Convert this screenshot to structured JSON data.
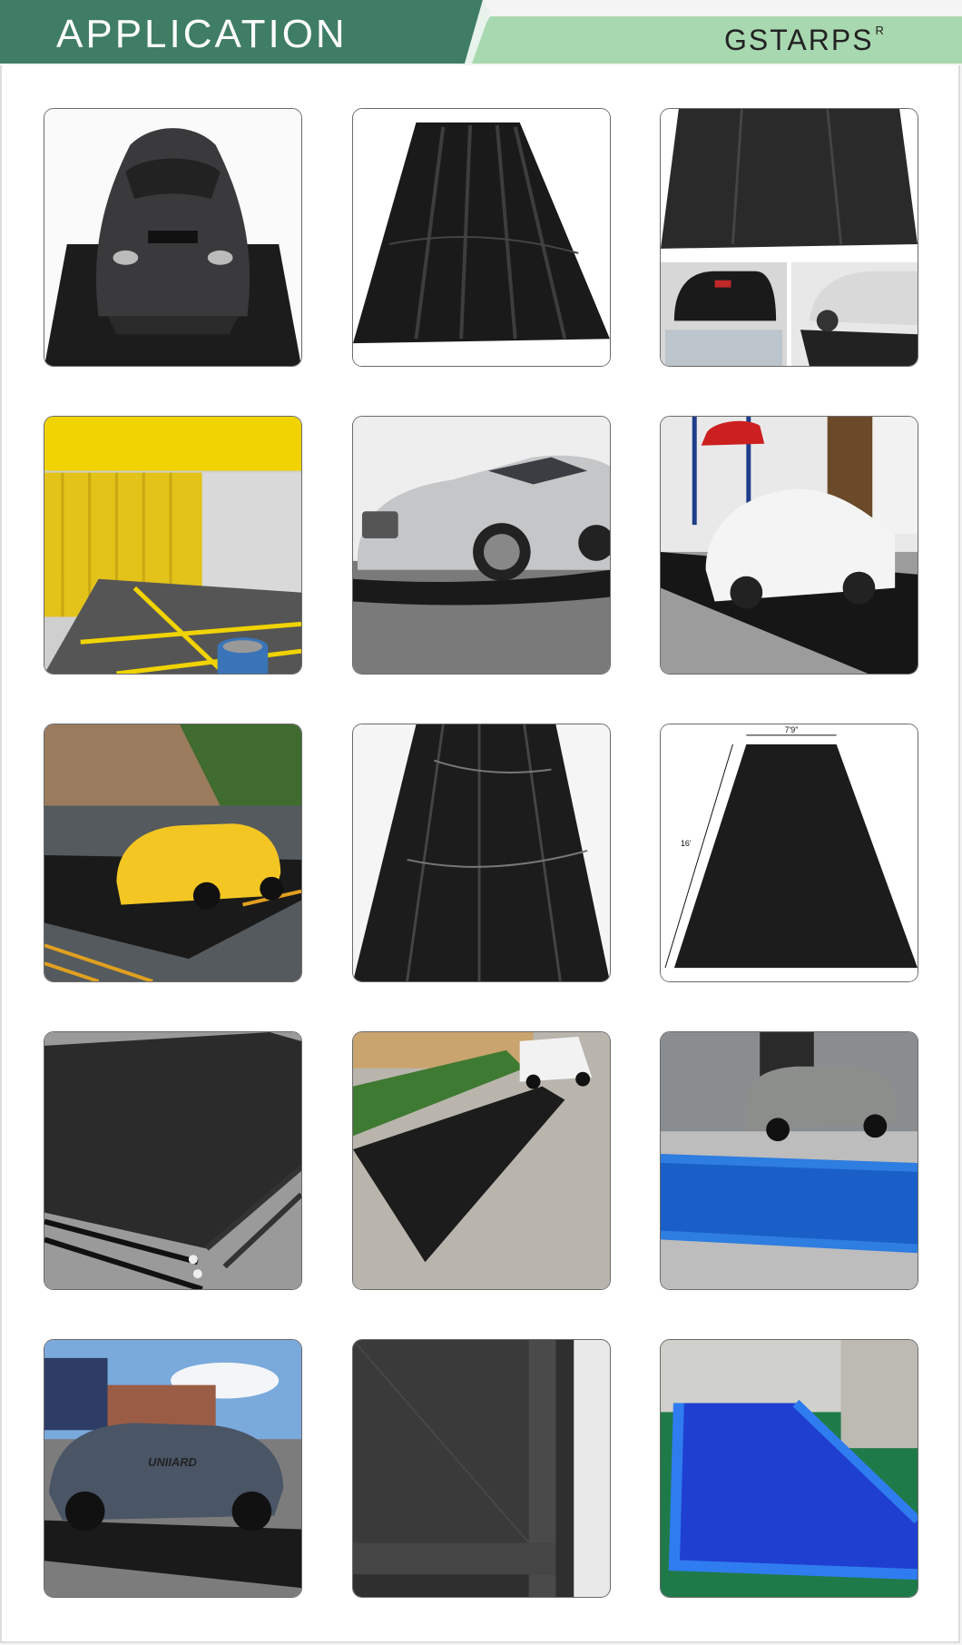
{
  "header": {
    "title": "APPLICATION",
    "brand": "GSTARPS",
    "brand_mark": "R",
    "colors": {
      "dark_green": "#3f7d64",
      "light_green": "#a8d8b0"
    }
  },
  "gallery": {
    "rows": 5,
    "columns": 3,
    "images": [
      {
        "subject": "sports car on black containment mat"
      },
      {
        "subject": "folded black PVC wash mat"
      },
      {
        "subject": "black mat and cars in garage"
      },
      {
        "subject": "yellow wash bay with curtains and checker floor"
      },
      {
        "subject": "silver sedan on inflatable berm mat"
      },
      {
        "subject": "white sedan on black mat in workshop"
      },
      {
        "subject": "yellow car on black mat in parking lot"
      },
      {
        "subject": "glossy black mat close-up"
      },
      {
        "subject": "black mat with dimensions",
        "labels": [
          "7'9\"",
          "16'"
        ]
      },
      {
        "subject": "stacked black mats"
      },
      {
        "subject": "black mat on concrete next to white van"
      },
      {
        "subject": "silver SUV with blue inflatable wash pool"
      },
      {
        "subject": "SUV on black mat outdoors",
        "labels": [
          "UNIIARD"
        ]
      },
      {
        "subject": "black mat edge close-up"
      },
      {
        "subject": "blue inflatable pool on green floor"
      }
    ]
  }
}
